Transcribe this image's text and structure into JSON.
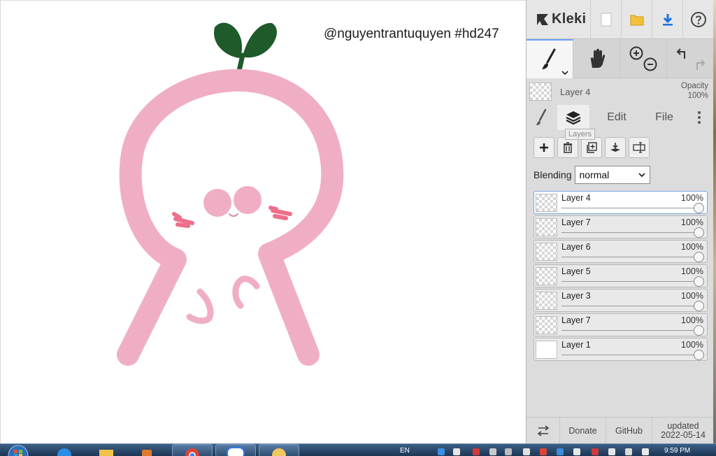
{
  "canvas": {
    "watermark": "@nguyentrantuquyen #hd247"
  },
  "app": {
    "name": "Kleki"
  },
  "current_layer": {
    "name": "Layer 4",
    "opacity_label": "Opacity",
    "opacity_value": "100%"
  },
  "tabs": {
    "edit": "Edit",
    "file": "File",
    "layers_tooltip": "Layers"
  },
  "blending": {
    "label": "Blending",
    "value": "normal"
  },
  "layers": [
    {
      "name": "Layer 4",
      "opacity": "100%",
      "active": true
    },
    {
      "name": "Layer 7",
      "opacity": "100%",
      "active": false
    },
    {
      "name": "Layer 6",
      "opacity": "100%",
      "active": false
    },
    {
      "name": "Layer 5",
      "opacity": "100%",
      "active": false
    },
    {
      "name": "Layer 3",
      "opacity": "100%",
      "active": false
    },
    {
      "name": "Layer 7",
      "opacity": "100%",
      "active": false
    },
    {
      "name": "Layer 1",
      "opacity": "100%",
      "active": false
    }
  ],
  "footer": {
    "donate": "Donate",
    "github": "GitHub",
    "updated_label": "updated",
    "updated_date": "2022-05-14"
  },
  "taskbar": {
    "language": "EN",
    "time": "9:59 PM"
  },
  "colors": {
    "accent": "#6aa0ff",
    "panel_bg": "#dcdcdc",
    "drawing_pink": "#f0aec4",
    "blush": "#ee6f8b",
    "leaf_green": "#1e5a2a"
  }
}
